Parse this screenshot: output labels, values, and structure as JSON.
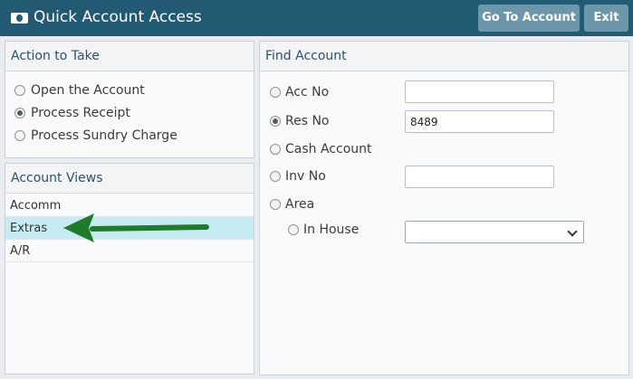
{
  "window": {
    "title": "Quick Account Access",
    "app_icon": "cash-register-icon",
    "buttons": {
      "go_to_account": "Go To Account",
      "exit": "Exit"
    },
    "accent_color": "#235a73"
  },
  "action_panel": {
    "header": "Action to Take",
    "options": [
      {
        "label": "Open the Account",
        "selected": false
      },
      {
        "label": "Process Receipt",
        "selected": true
      },
      {
        "label": "Process Sundry Charge",
        "selected": false
      }
    ]
  },
  "views_panel": {
    "header": "Account Views",
    "items": [
      {
        "label": "Accomm",
        "selected": false
      },
      {
        "label": "Extras",
        "selected": true
      },
      {
        "label": "A/R",
        "selected": false
      }
    ],
    "selected_color": "#c6ebf2"
  },
  "find_panel": {
    "header": "Find Account",
    "acc_no": {
      "label": "Acc No",
      "value": ""
    },
    "res_no": {
      "label": "Res No",
      "value": "8489",
      "selected": true
    },
    "cash_account": {
      "label": "Cash Account"
    },
    "inv_no": {
      "label": "Inv No",
      "value": ""
    },
    "area": {
      "label": "Area"
    },
    "in_house": {
      "label": "In House",
      "value": ""
    }
  },
  "annotation": {
    "arrow_icon": "green-arrow-icon",
    "arrow_color": "#1f7a2b"
  }
}
